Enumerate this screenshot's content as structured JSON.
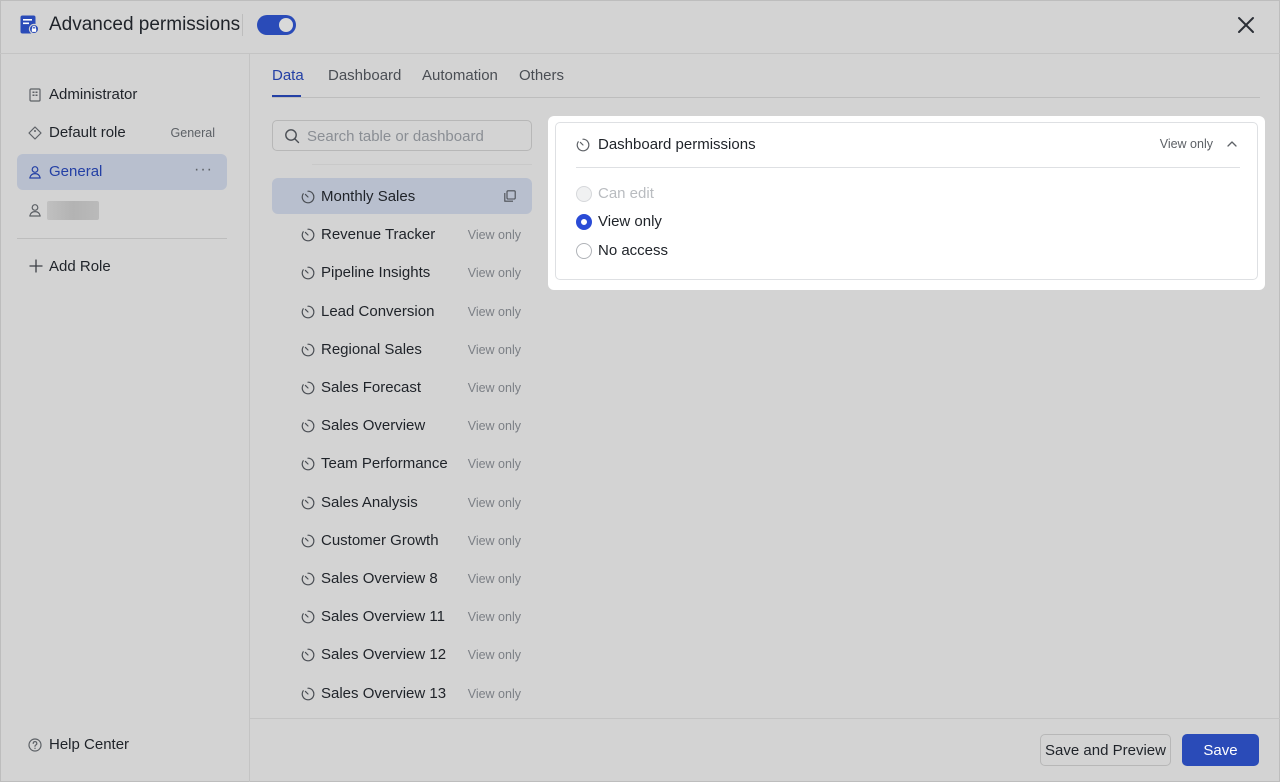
{
  "header": {
    "title": "Advanced permissions",
    "toggle_on": true
  },
  "sidebar": {
    "roles": [
      {
        "label": "Administrator",
        "tag": "",
        "icon": "building-icon"
      },
      {
        "label": "Default role",
        "tag": "General",
        "icon": "diamond-icon"
      },
      {
        "label": "General",
        "tag": "",
        "icon": "user-icon",
        "active": true
      },
      {
        "label": "",
        "tag": "",
        "icon": "user-icon",
        "blurred": true
      }
    ],
    "add_role": "Add Role",
    "help": "Help Center"
  },
  "tabs": [
    "Data",
    "Dashboard",
    "Automation",
    "Others"
  ],
  "search": {
    "placeholder": "Search table or dashboard",
    "value": ""
  },
  "dashboards": [
    {
      "name": "Monthly Sales",
      "permission": ""
    },
    {
      "name": "Revenue Tracker",
      "permission": "View only"
    },
    {
      "name": "Pipeline Insights",
      "permission": "View only"
    },
    {
      "name": "Lead Conversion",
      "permission": "View only"
    },
    {
      "name": "Regional Sales",
      "permission": "View only"
    },
    {
      "name": "Sales Forecast",
      "permission": "View only"
    },
    {
      "name": "Sales Overview",
      "permission": "View only"
    },
    {
      "name": "Team Performance",
      "permission": "View only"
    },
    {
      "name": "Sales Analysis",
      "permission": "View only"
    },
    {
      "name": "Customer Growth",
      "permission": "View only"
    },
    {
      "name": "Sales Overview 8",
      "permission": "View only"
    },
    {
      "name": "Sales Overview 11",
      "permission": "View only"
    },
    {
      "name": "Sales Overview 12",
      "permission": "View only"
    },
    {
      "name": "Sales Overview 13",
      "permission": "View only"
    }
  ],
  "panel": {
    "title": "Dashboard permissions",
    "current": "View only",
    "options": [
      {
        "label": "Can edit",
        "state": "disabled"
      },
      {
        "label": "View only",
        "state": "checked"
      },
      {
        "label": "No access",
        "state": "unchecked"
      }
    ]
  },
  "footer": {
    "save_preview": "Save and Preview",
    "save": "Save"
  },
  "colors": {
    "accent": "#2a4bb8",
    "active_text": "#2440a5",
    "background": "#d3d3d3"
  }
}
